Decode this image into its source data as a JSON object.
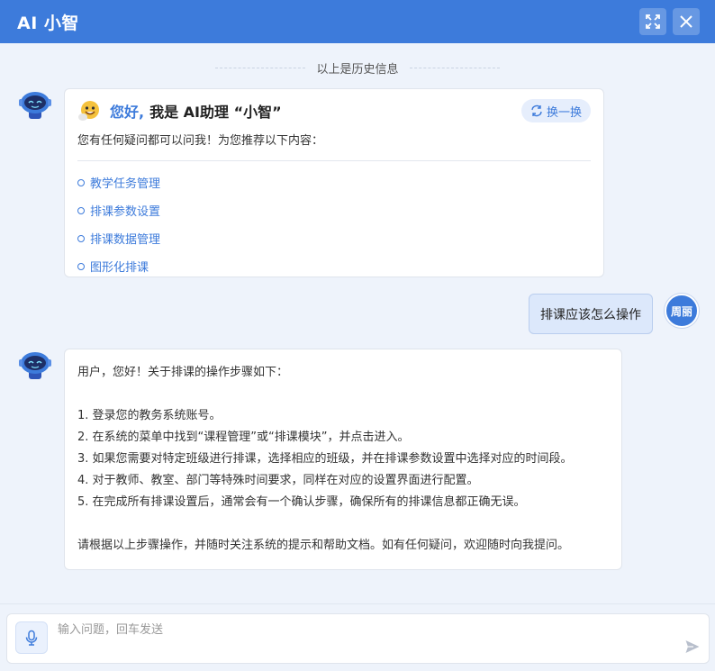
{
  "header": {
    "title": "AI 小智",
    "expand_icon": "expand-icon",
    "close_icon": "close-icon",
    "color": "#3d7bdb"
  },
  "history_label": "以上是历史信息",
  "welcome": {
    "hi": "您好,",
    "intro": "我是 AI助理 “小智”",
    "swap_label": "换一换",
    "subtitle": "您有任何疑问都可以问我！为您推荐以下内容：",
    "suggestions": [
      "教学任务管理",
      "排课参数设置",
      "排课数据管理",
      "图形化排课"
    ]
  },
  "user": {
    "message": "排课应该怎么操作",
    "avatar_text": "周丽"
  },
  "reply": {
    "lines": [
      "用户，您好！关于排课的操作步骤如下：",
      "",
      "1. 登录您的教务系统账号。",
      "2. 在系统的菜单中找到“课程管理”或“排课模块”，并点击进入。",
      "3. 如果您需要对特定班级进行排课，选择相应的班级，并在排课参数设置中选择对应的时间段。",
      "4. 对于教师、教室、部门等特殊时间要求，同样在对应的设置界面进行配置。",
      "5. 在完成所有排课设置后，通常会有一个确认步骤，确保所有的排课信息都正确无误。",
      "",
      "请根据以上步骤操作，并随时关注系统的提示和帮助文档。如有任何疑问，欢迎随时向我提问。"
    ]
  },
  "input": {
    "placeholder": "输入问题，回车发送",
    "value": "",
    "mic_icon": "microphone-icon",
    "send_icon": "send-icon"
  }
}
